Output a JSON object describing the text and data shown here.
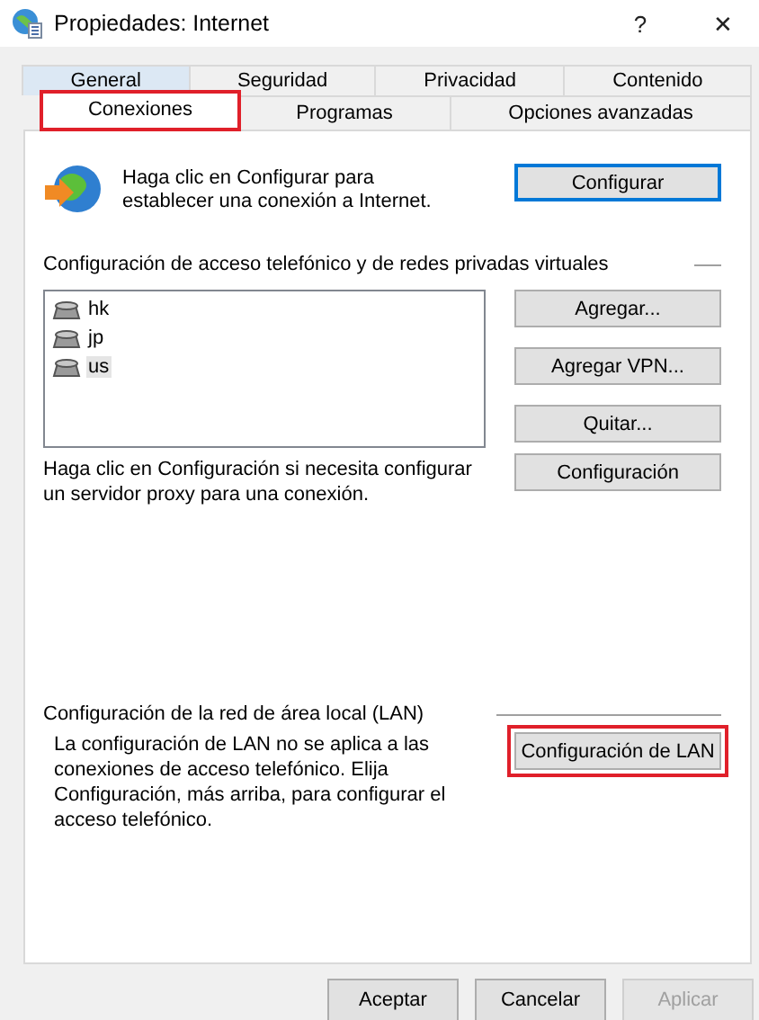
{
  "window": {
    "title": "Propiedades: Internet",
    "help": "?",
    "close": "✕"
  },
  "tab_rows": [
    [
      {
        "label": "General",
        "selected": false,
        "highlighted": false
      },
      {
        "label": "Seguridad",
        "selected": false,
        "highlighted": false
      },
      {
        "label": "Privacidad",
        "selected": false,
        "highlighted": false
      },
      {
        "label": "Contenido",
        "selected": false,
        "highlighted": false
      }
    ],
    [
      {
        "label": "Conexiones",
        "selected": true,
        "highlighted": true
      },
      {
        "label": "Programas",
        "selected": false,
        "highlighted": false
      },
      {
        "label": "Opciones avanzadas",
        "selected": false,
        "highlighted": false
      }
    ]
  ],
  "setup": {
    "text": "Haga clic en Configurar para establecer una conexión a Internet.",
    "button": "Configurar"
  },
  "dialup": {
    "heading": "Configuración de acceso telefónico y de redes privadas virtuales",
    "connections": [
      {
        "name": "hk",
        "selected": false
      },
      {
        "name": "jp",
        "selected": false
      },
      {
        "name": "us",
        "selected": true
      }
    ],
    "buttons": [
      {
        "label": "Agregar..."
      },
      {
        "label": "Agregar VPN..."
      },
      {
        "label": "Quitar..."
      }
    ],
    "proxy_text": "Haga clic en Configuración si necesita configurar un servidor proxy para una conexión.",
    "settings_button": "Configuración"
  },
  "lan": {
    "heading": "Configuración de la red de área local (LAN)",
    "text": "La configuración de LAN no se aplica a las conexiones de acceso telefónico. Elija Configuración, más arriba, para configurar el acceso telefónico.",
    "button": "Configuración de LAN",
    "highlighted": true
  },
  "footer": [
    {
      "label": "Aceptar",
      "disabled": false
    },
    {
      "label": "Cancelar",
      "disabled": false
    },
    {
      "label": "Aplicar",
      "disabled": true
    }
  ]
}
